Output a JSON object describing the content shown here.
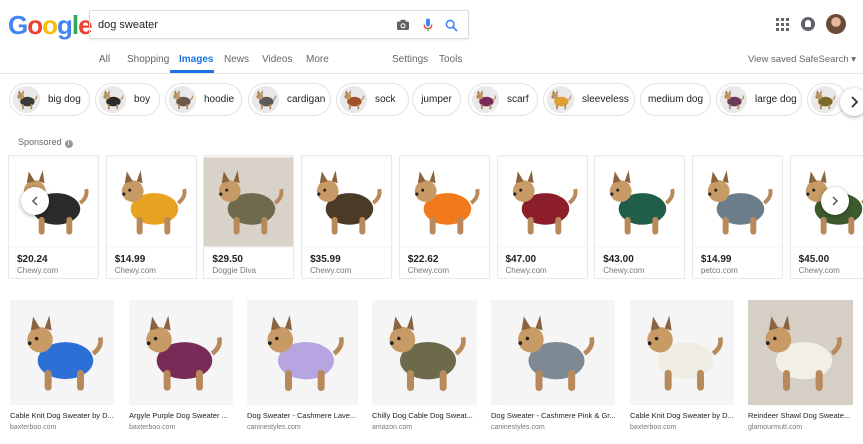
{
  "logo": {
    "letters": [
      "G",
      "o",
      "o",
      "g",
      "l",
      "e"
    ],
    "colors": [
      "#4285F4",
      "#EA4335",
      "#FBBC05",
      "#4285F4",
      "#34A853",
      "#EA4335"
    ]
  },
  "search": {
    "query": "dog sweater"
  },
  "tabs": [
    "All",
    "Shopping",
    "Images",
    "News",
    "Videos",
    "More"
  ],
  "active_tab": "Images",
  "tools": {
    "settings": "Settings",
    "tools": "Tools"
  },
  "header_right": {
    "view_saved": "View saved",
    "safesearch": "SafeSearch ▾"
  },
  "chips": [
    {
      "label": "big dog",
      "thumb": "dog-icon"
    },
    {
      "label": "boy",
      "thumb": "dog-icon"
    },
    {
      "label": "hoodie",
      "thumb": "dog-icon"
    },
    {
      "label": "cardigan",
      "thumb": "sweater-icon"
    },
    {
      "label": "sock",
      "thumb": "dog-icon"
    },
    {
      "label": "jumper",
      "thumb": ""
    },
    {
      "label": "scarf",
      "thumb": "dog-icon"
    },
    {
      "label": "sleeveless",
      "thumb": "dog-icon"
    },
    {
      "label": "medium dog",
      "thumb": ""
    },
    {
      "label": "large dog",
      "thumb": "dog-icon"
    }
  ],
  "sponsored_label": "Sponsored",
  "products": [
    {
      "price": "$20.24",
      "store": "Chewy.com",
      "color": "#2b2b2b"
    },
    {
      "price": "$14.99",
      "store": "Chewy.com",
      "color": "#e8a221"
    },
    {
      "price": "$29.50",
      "store": "Doggie Diva",
      "color": "#6e6a4f"
    },
    {
      "price": "$35.99",
      "store": "Chewy.com",
      "color": "#4a3a26"
    },
    {
      "price": "$22.62",
      "store": "Chewy.com",
      "color": "#f07a1a"
    },
    {
      "price": "$47.00",
      "store": "Chewy.com",
      "color": "#8b1e2a"
    },
    {
      "price": "$43.00",
      "store": "Chewy.com",
      "color": "#1f5e48"
    },
    {
      "price": "$14.99",
      "store": "petco.com",
      "color": "#6b7d8a"
    },
    {
      "price": "$45.00",
      "store": "Chewy.com",
      "color": "#3d5a2d"
    }
  ],
  "results": [
    {
      "title": "Cable Knit Dog Sweater by D...",
      "source": "baxterboo.com",
      "color": "#2c6fd6"
    },
    {
      "title": "Argyle Purple Dog Sweater ...",
      "source": "baxterboo.com",
      "color": "#7a2a56"
    },
    {
      "title": "Dog Sweater - Cashmere Lave...",
      "source": "caninestyles.com",
      "color": "#b7a5e2"
    },
    {
      "title": "Chilly Dog Cable Dog Sweat...",
      "source": "amazon.com",
      "color": "#6c6a4a"
    },
    {
      "title": "Dog Sweater - Cashmere Pink & Gr...",
      "source": "caninestyles.com",
      "color": "#7d8a94"
    },
    {
      "title": "Cable Knit Dog Sweater by D...",
      "source": "baxterboo.com",
      "color": "#efece3"
    },
    {
      "title": "Reindeer Shawl Dog Sweate...",
      "source": "glamourmutt.com",
      "color": "#f2efe6"
    }
  ]
}
